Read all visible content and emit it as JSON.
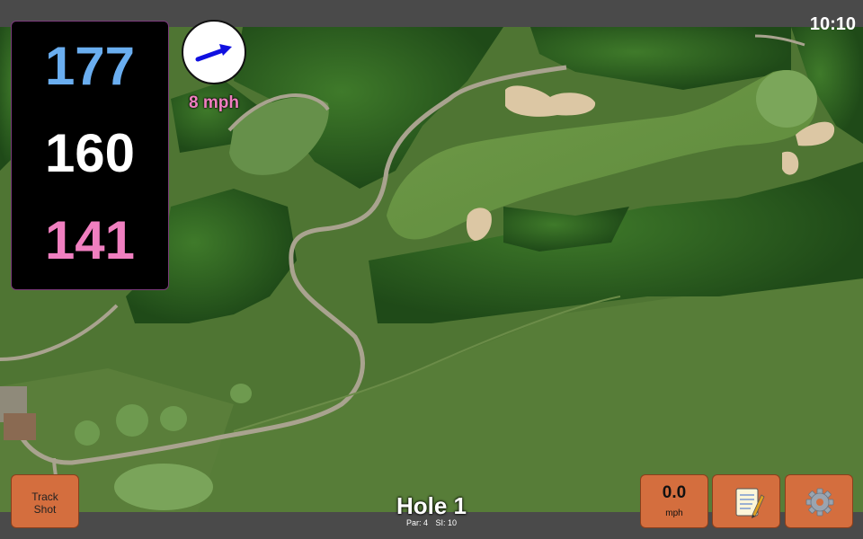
{
  "status": {
    "time": "10:10"
  },
  "distances": {
    "back": "177",
    "middle": "160",
    "front": "141",
    "colors": {
      "back": "#6aaef0",
      "middle": "#ffffff",
      "front": "#f07fc0"
    }
  },
  "wind": {
    "speed_label": "8 mph",
    "arrow_icon": "wind-arrow-icon",
    "arrow_color": "#1010e0"
  },
  "buttons": {
    "track_shot": {
      "line1": "Track",
      "line2": "Shot"
    },
    "speed": {
      "value": "0.0",
      "unit": "mph"
    },
    "notes_icon": "notepad-icon",
    "settings_icon": "gear-icon",
    "button_color": "#d46e3e"
  },
  "hole": {
    "title": "Hole 1",
    "par_label": "Par: 4",
    "si_label": "SI: 10"
  }
}
